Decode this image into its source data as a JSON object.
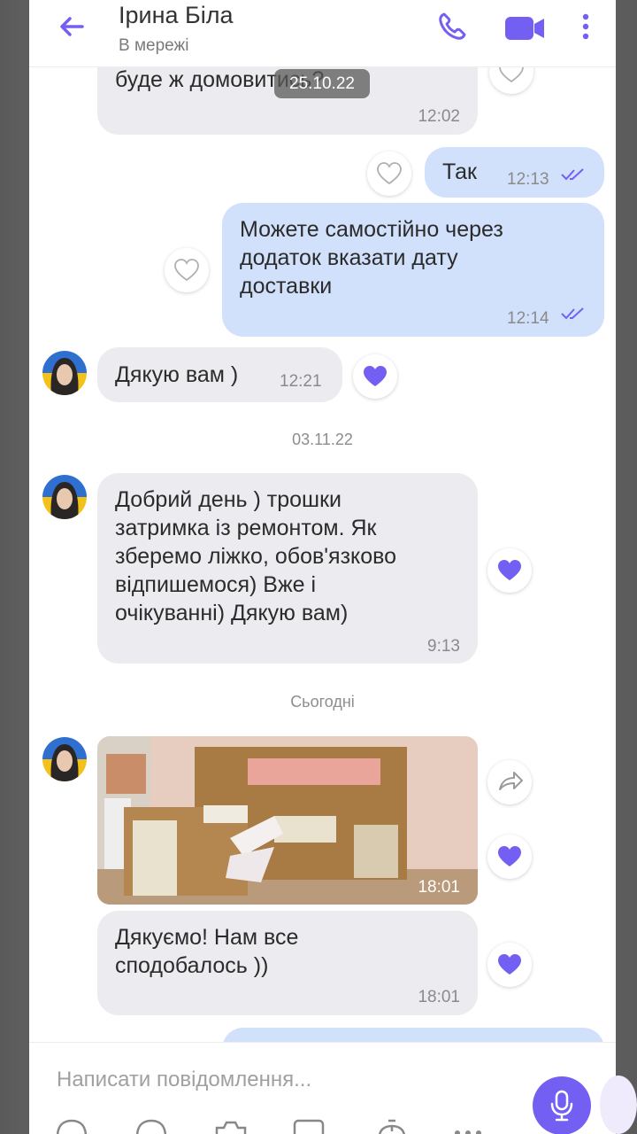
{
  "header": {
    "contact_name": "Ірина Біла",
    "status": "В мережі",
    "accent": "#7360f2"
  },
  "chat": {
    "floating_date": "25.10.22",
    "messages": [
      {
        "dir": "in",
        "text": "буде ж домовитись?",
        "time": "12:02",
        "liked": false
      },
      {
        "dir": "out",
        "text": "Так",
        "time": "12:13",
        "liked": false
      },
      {
        "dir": "out",
        "text": "Можете самостійно через\nдодаток вказати дату\nдоставки",
        "time": "12:14",
        "liked": false
      },
      {
        "dir": "in",
        "text": "Дякую вам )",
        "time": "12:21",
        "liked": true
      },
      {
        "dir": "in",
        "text": "Добрий день ) трошки\nзатримка із ремонтом. Як\nзберемо ліжко, обов'язково\nвідпишемося) Вже і\nочікуванні) Дякую вам)",
        "time": "9:13",
        "liked": true
      },
      {
        "dir": "in",
        "type": "photo",
        "time": "18:01",
        "liked": true
      },
      {
        "dir": "in",
        "text": "Дякуємо! Нам все\nсподобалось ))",
        "time": "18:01",
        "liked": true
      }
    ],
    "date_separators": [
      "03.11.22",
      "Сьогодні"
    ]
  },
  "composer": {
    "placeholder": "Написати повідомлення..."
  },
  "icons": {
    "back": "arrow-left-icon",
    "call": "phone-icon",
    "video": "video-camera-icon",
    "more": "more-vertical-icon",
    "like": "heart-icon",
    "share": "share-icon",
    "mic": "microphone-icon"
  },
  "colors": {
    "accent": "#7360f2",
    "incoming_bubble": "#ececf0",
    "outgoing_bubble": "#d1e1fb"
  }
}
